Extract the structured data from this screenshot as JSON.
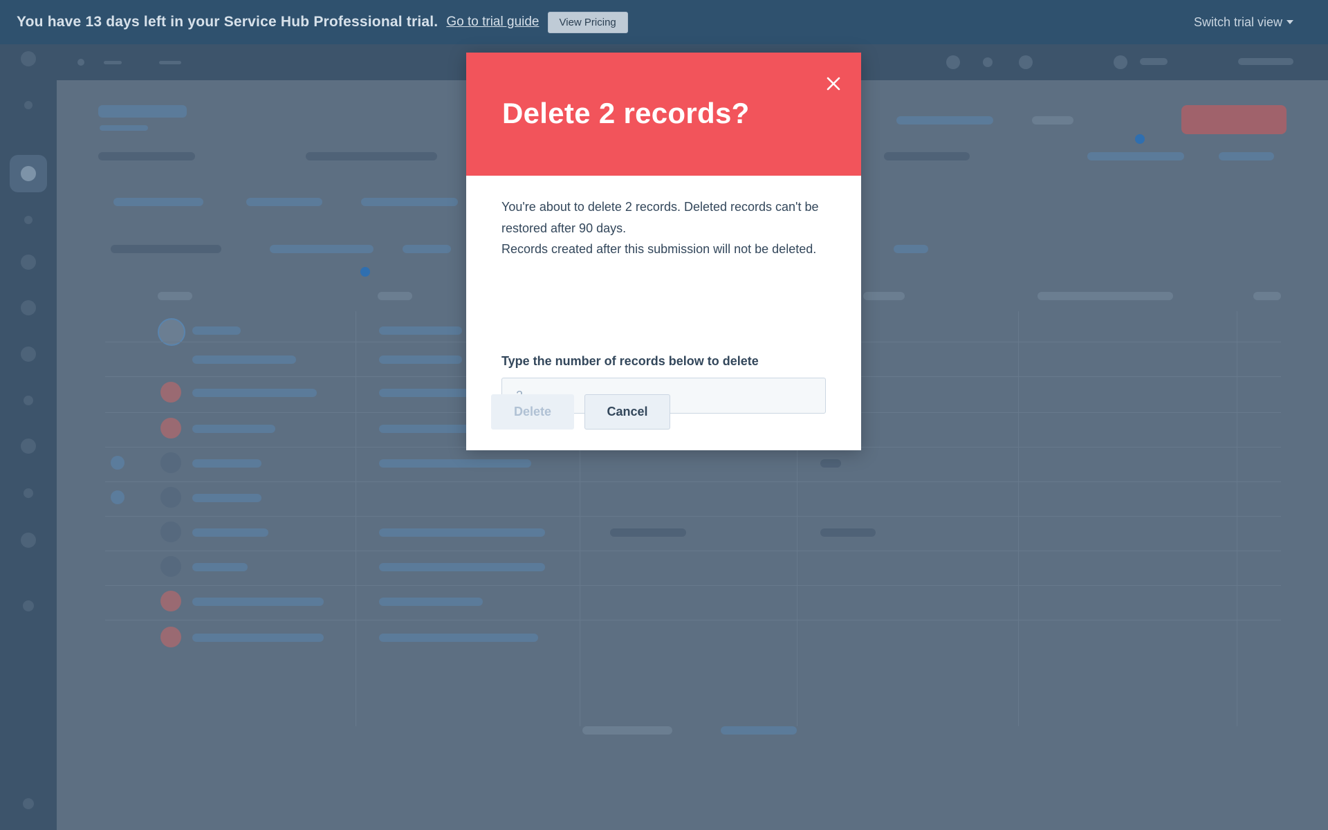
{
  "banner": {
    "message": "You have 13 days left in your Service Hub Professional trial.",
    "guide_link": "Go to trial guide",
    "pricing_button": "View Pricing",
    "switch_view": "Switch trial view"
  },
  "modal": {
    "title": "Delete 2 records?",
    "body_line1": "You're about to delete 2 records. Deleted records can't be restored after 90 days.",
    "body_line2": "Records created after this submission will not be deleted.",
    "input_label": "Type the number of records below to delete",
    "input_placeholder": "2",
    "input_value": "",
    "delete_button": "Delete",
    "cancel_button": "Cancel",
    "close_icon": "close-icon"
  },
  "colors": {
    "banner_bg": "#2f516e",
    "modal_header_bg": "#f2545b",
    "overlay_bg": "#5c6e80",
    "text_primary": "#33475b"
  }
}
